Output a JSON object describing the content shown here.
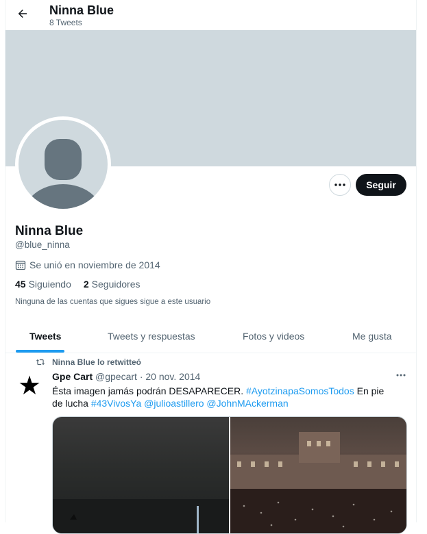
{
  "header": {
    "name": "Ninna Blue",
    "tweet_count": "8 Tweets"
  },
  "profile": {
    "name": "Ninna Blue",
    "handle": "@blue_ninna",
    "joined": "Se unió en noviembre de 2014",
    "following_count": "45",
    "following_label": "Siguiendo",
    "followers_count": "2",
    "followers_label": "Seguidores",
    "not_followed_note": "Ninguna de las cuentas que sigues sigue a este usuario",
    "follow_button": "Seguir"
  },
  "tabs": [
    {
      "label": "Tweets",
      "active": true
    },
    {
      "label": "Tweets y respuestas",
      "active": false
    },
    {
      "label": "Fotos y videos",
      "active": false
    },
    {
      "label": "Me gusta",
      "active": false
    }
  ],
  "tweet": {
    "retweet_note": "Ninna Blue lo retwitteó",
    "author": "Gpe Cart",
    "handle": "@gpecart",
    "separator": "·",
    "date": "20 nov. 2014",
    "text_1": "Ésta imagen jamás podrán DESAPARECER. ",
    "hashtag_1": "#AyotzinapaSomosTodos",
    "text_2": " En pie de lucha ",
    "hashtag_2": "#43VivosYa",
    "mention_1": "@julioastillero",
    "mention_2": "@JohnMAckerman"
  },
  "colors": {
    "accent": "#1d9bf0",
    "banner": "#cfd9de",
    "button_dark": "#0f1419",
    "secondary_text": "#536471"
  },
  "icons": [
    "back-arrow-icon",
    "calendar-icon",
    "more-icon",
    "retweet-icon",
    "star-icon"
  ]
}
